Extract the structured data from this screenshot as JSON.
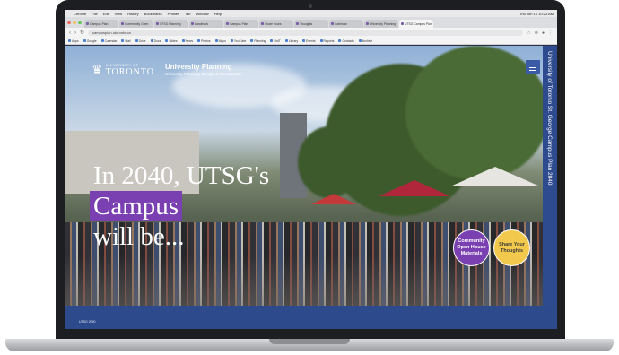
{
  "menubar": {
    "apple": "",
    "items": [
      "Chrome",
      "File",
      "Edit",
      "View",
      "History",
      "Bookmarks",
      "Profiles",
      "Tab",
      "Window",
      "Help"
    ],
    "clock": "Thu Jun 16 10:23 AM"
  },
  "tabs": [
    {
      "label": "Campus Plan"
    },
    {
      "label": "Community Open"
    },
    {
      "label": "UTSG Planning"
    },
    {
      "label": "Landmark"
    },
    {
      "label": "Campus Plan"
    },
    {
      "label": "Share Yours"
    },
    {
      "label": "Thoughts"
    },
    {
      "label": "Calendar"
    },
    {
      "label": "University Planning"
    },
    {
      "label": "UTSG Campus Plan"
    }
  ],
  "address": {
    "url": "campusplan.utoronto.ca",
    "back": "‹",
    "forward": "›",
    "reload": "↻"
  },
  "bookmarks": [
    "Apps",
    "Google",
    "Calendar",
    "Mail",
    "Drive",
    "Docs",
    "Slides",
    "News",
    "Photos",
    "Maps",
    "YouTube",
    "Planning",
    "UofT",
    "Library",
    "Events",
    "Reports",
    "Contacts",
    "Archive"
  ],
  "site": {
    "crest_glyph": "♛",
    "university_small": "UNIVERSITY OF",
    "university_big": "TORONTO",
    "unit_title": "University Planning",
    "unit_sub": "University Planning, Design & Construction",
    "side_banner": "University of Toronto St. George Campus Plan 2040",
    "headline_line1": "In 2040, UTSG's",
    "headline_line2": "Campus",
    "headline_line3": "will be...",
    "cta_primary": "Community Open House Materials",
    "cta_secondary": "Share Your Thoughts",
    "footer": "UTSG 2040"
  },
  "colors": {
    "accent_purple": "#7a3fb0",
    "accent_blue": "#2e4b8f",
    "accent_yellow": "#f2c94c"
  }
}
